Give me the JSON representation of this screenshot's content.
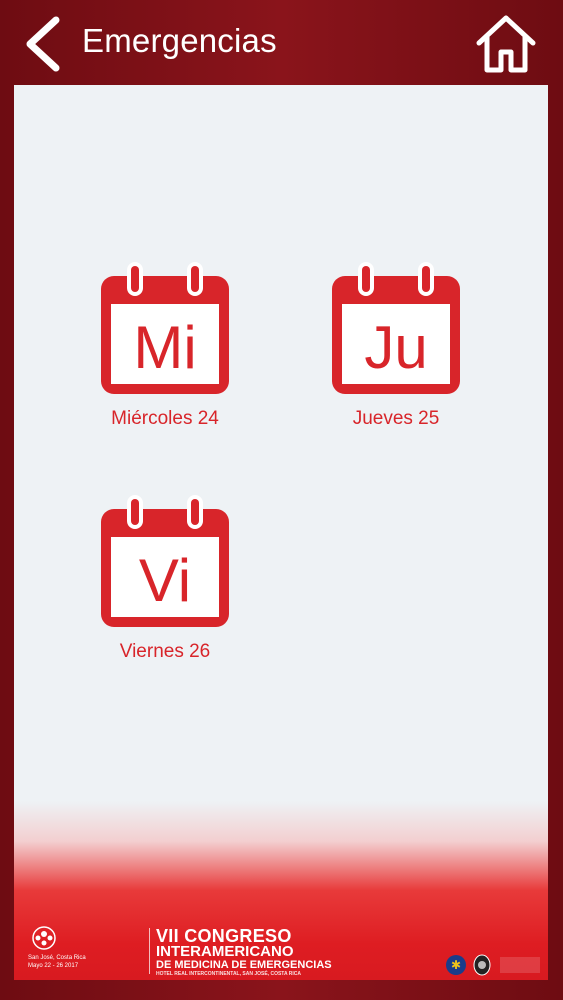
{
  "header": {
    "title": "Emergencias",
    "back_icon": "chevron-left-icon",
    "home_icon": "home-icon"
  },
  "days": [
    {
      "abbr": "Mi",
      "label": "Miércoles 24"
    },
    {
      "abbr": "Ju",
      "label": "Jueves 25"
    },
    {
      "abbr": "Vi",
      "label": "Viernes 26"
    }
  ],
  "banner": {
    "location": "San José, Costa Rica",
    "dates": "Mayo 22 - 26 2017",
    "congress_line1": "VII CONGRESO",
    "congress_line2": "INTERAMERICANO",
    "congress_line3": "DE MEDICINA DE EMERGENCIAS",
    "venue": "HOTEL REAL INTERCONTINENTAL, SAN JOSÉ, COSTA RICA"
  },
  "colors": {
    "frame": "#7a1016",
    "accent": "#d8252a",
    "content_bg": "#eef2f5"
  }
}
